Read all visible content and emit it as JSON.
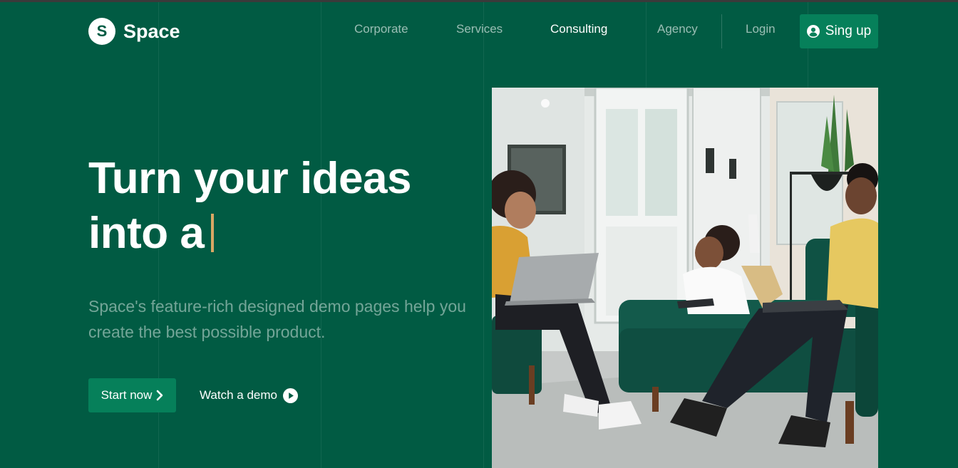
{
  "brand": {
    "logo_letter": "S",
    "name": "Space"
  },
  "nav": {
    "items": [
      {
        "label": "Corporate",
        "active": false
      },
      {
        "label": "Services",
        "active": false
      },
      {
        "label": "Consulting",
        "active": true
      },
      {
        "label": "Agency",
        "active": false
      }
    ],
    "login_label": "Login",
    "signup_label": "Sing up"
  },
  "hero": {
    "title_line1": "Turn your ideas",
    "title_line2": "into a",
    "description": "Space's feature-rich designed demo pages help you create the best possible product.",
    "start_label": "Start now",
    "demo_label": "Watch a demo"
  },
  "colors": {
    "background": "#015b43",
    "button": "#06805a",
    "cursor_accent": "#d9a864"
  },
  "icons": {
    "user": "user-circle-icon",
    "chevron": "chevron-right-icon",
    "play": "play-circle-icon"
  }
}
